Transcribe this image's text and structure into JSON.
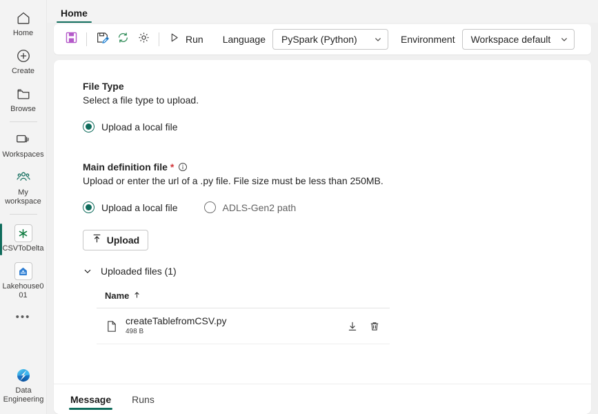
{
  "rail": {
    "items": [
      {
        "label": "Home",
        "icon": "home-icon"
      },
      {
        "label": "Create",
        "icon": "plus-circle-icon"
      },
      {
        "label": "Browse",
        "icon": "folder-icon"
      },
      {
        "label": "Workspaces",
        "icon": "workspaces-icon"
      },
      {
        "label": "My workspace",
        "icon": "people-icon"
      },
      {
        "label": "CSVToDelta",
        "icon": "spark-asterisk-icon"
      },
      {
        "label": "Lakehouse001",
        "icon": "lakehouse-icon"
      }
    ],
    "more_label": "•••",
    "footer": {
      "label": "Data Engineering",
      "icon": "data-engineering-icon"
    }
  },
  "tabstrip": {
    "home_tab": "Home"
  },
  "toolbar": {
    "save_icon": "save-floppy-icon",
    "save_as_icon": "save-as-pencil-icon",
    "refresh_icon": "refresh-icon",
    "settings_icon": "gear-icon",
    "run_label": "Run",
    "run_icon": "play-icon",
    "language_label": "Language",
    "language_value": "PySpark (Python)",
    "environment_label": "Environment",
    "environment_value": "Workspace default",
    "chevron_icon": "chevron-down-icon"
  },
  "form": {
    "file_type": {
      "title": "File Type",
      "description": "Select a file type to upload.",
      "option_label": "Upload a local file"
    },
    "main_definition": {
      "title": "Main definition file",
      "required_mark": "*",
      "info_icon": "info-circle-icon",
      "description": "Upload or enter the url of a .py file. File size must be less than 250MB.",
      "option_local": "Upload a local file",
      "option_adls": "ADLS-Gen2 path",
      "upload_button": "Upload",
      "upload_icon": "upload-arrow-icon",
      "collapse_icon": "chevron-down-icon",
      "uploaded_files_label": "Uploaded files (1)"
    },
    "file_table": {
      "columns": [
        "Name"
      ],
      "sort_icon": "sort-ascending-arrow",
      "rows": [
        {
          "icon": "file-document-icon",
          "name": "createTablefromCSV.py",
          "size": "498 B",
          "download_icon": "download-icon",
          "delete_icon": "trash-icon"
        }
      ]
    }
  },
  "bottom_tabs": {
    "items": [
      {
        "label": "Message",
        "active": true
      },
      {
        "label": "Runs",
        "active": false
      }
    ]
  },
  "colors": {
    "accent_teal": "#0f6c5c",
    "save_purple": "#b459c9",
    "refresh_green": "#2e8b57",
    "pencil_blue": "#1a7fd4",
    "required_red": "#d13438",
    "lakehouse_blue": "#2d7dd2"
  }
}
